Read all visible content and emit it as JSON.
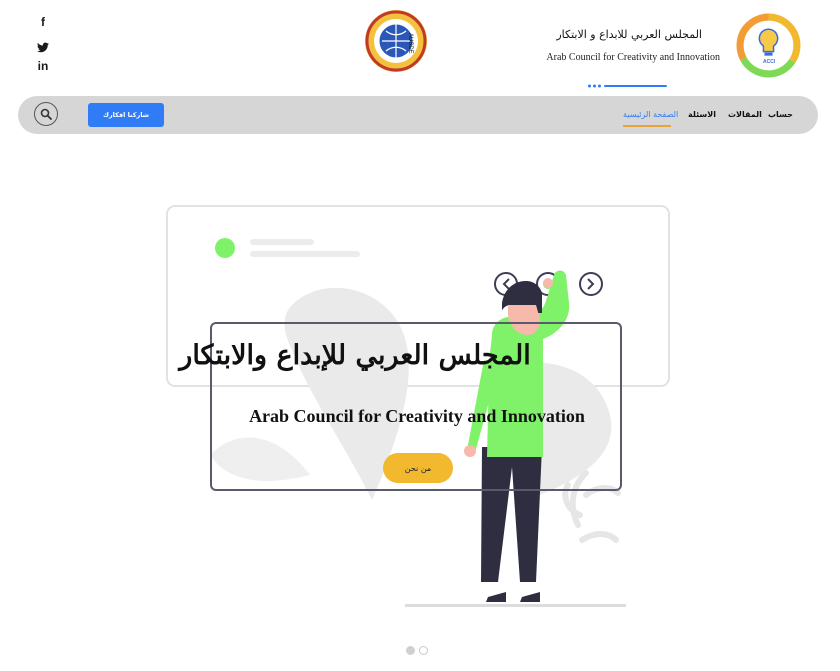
{
  "social": [
    {
      "icon": "facebook-icon",
      "glyph": "f"
    },
    {
      "icon": "twitter-icon",
      "glyph": "t"
    },
    {
      "icon": "linkedin-icon",
      "glyph": "in"
    }
  ],
  "partner_logo": {
    "text": "AUSDE"
  },
  "brand": {
    "name_ar": "المجلس العربي للابداع و الابتكار",
    "name_en": "Arab Council for Creativity and Innovation",
    "logo_text": "ACCI"
  },
  "nav": {
    "items": [
      "حساب",
      "المقالات",
      "الاسئلة",
      "الصفحة الرئيسية"
    ],
    "active_index": 3,
    "cta_label": "شاركنا افكارك"
  },
  "hero": {
    "title_ar": "المجلس العربي للإبداع والابتكار",
    "subtitle_en": "Arab Council for Creativity and Innovation",
    "button_label": "من نحن"
  },
  "carousel": {
    "slide_count": 2,
    "active_index": 0
  },
  "colors": {
    "accent_blue": "#2f7cf6",
    "nav_bg": "#d6d6d6",
    "active_underline": "#e8a23a",
    "button_yellow": "#f2b82e",
    "illustration_green": "#80f26a",
    "illustration_dark": "#2f2e41"
  }
}
